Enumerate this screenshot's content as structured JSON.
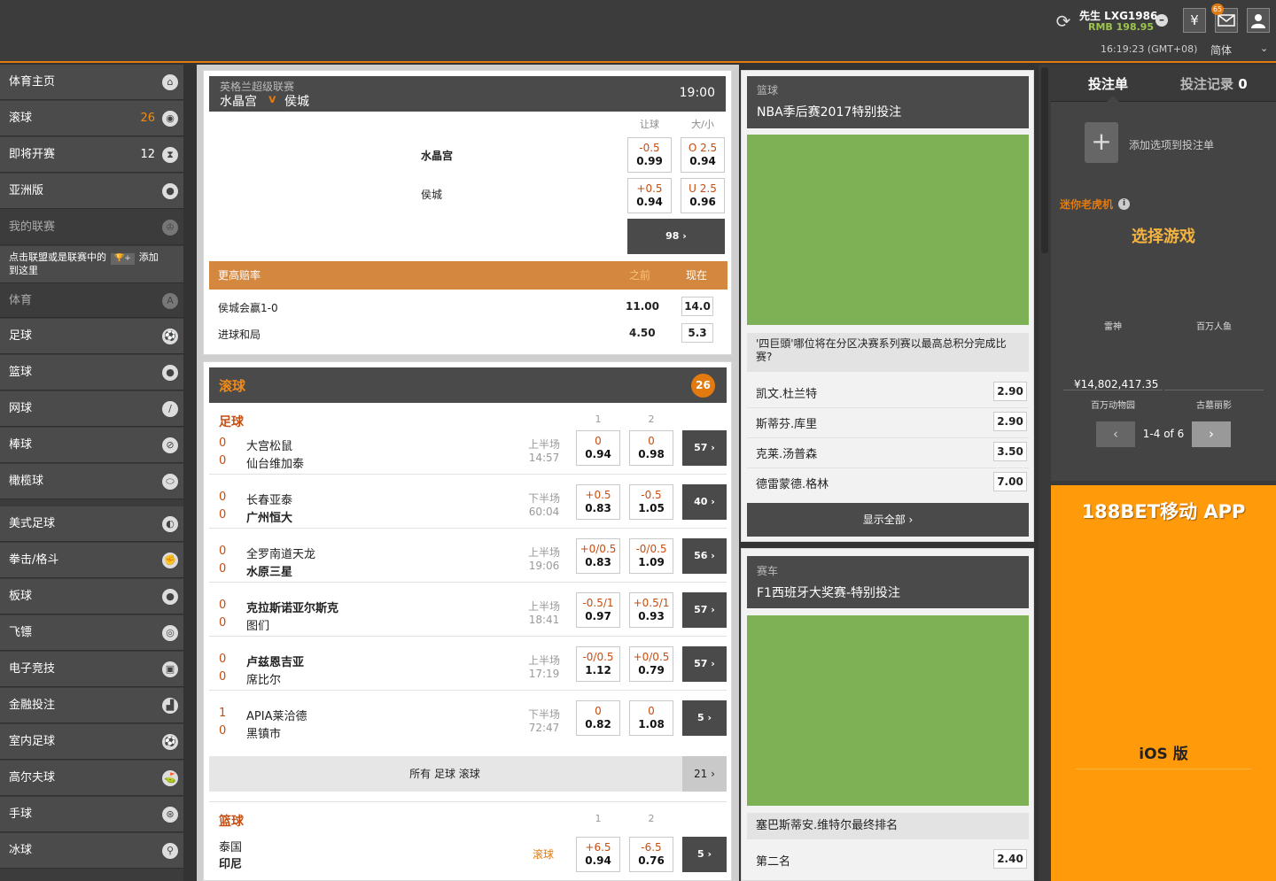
{
  "header": {
    "username": "先生 LXG1986",
    "balance": "RMB 198.95",
    "mail_count": "65",
    "clock": "16:19:23 (GMT+08)",
    "language": "简体",
    "currency_symbol": "¥",
    "refresh_symbol": "⟳",
    "minus_symbol": "–"
  },
  "sidebar": {
    "items": [
      {
        "label": "体育主页",
        "count": "",
        "icon": "home-icon"
      },
      {
        "label": "滚球",
        "count": "26",
        "icon": "live-icon"
      },
      {
        "label": "即将开赛",
        "count": "12",
        "icon": "hourglass-icon"
      },
      {
        "label": "亚洲版",
        "count": "",
        "icon": "globe-icon"
      },
      {
        "label": "我的联赛",
        "count": "",
        "icon": "trophy-icon"
      },
      {
        "label": "体育",
        "count": "",
        "icon": "sort-az-icon"
      },
      {
        "label": "足球",
        "icon": "soccer-icon"
      },
      {
        "label": "篮球",
        "icon": "basketball-icon"
      },
      {
        "label": "网球",
        "icon": "tennis-icon"
      },
      {
        "label": "棒球",
        "icon": "baseball-icon"
      },
      {
        "label": "橄榄球",
        "icon": "rugby-icon"
      },
      {
        "label": "美式足球",
        "icon": "american-football-icon"
      },
      {
        "label": "拳击/格斗",
        "icon": "boxing-icon"
      },
      {
        "label": "板球",
        "icon": "cricket-icon"
      },
      {
        "label": "飞镖",
        "icon": "darts-icon"
      },
      {
        "label": "电子竞技",
        "icon": "esports-icon"
      },
      {
        "label": "金融投注",
        "icon": "finance-icon"
      },
      {
        "label": "室内足球",
        "icon": "futsal-icon"
      },
      {
        "label": "高尔夫球",
        "icon": "golf-icon"
      },
      {
        "label": "手球",
        "icon": "handball-icon"
      },
      {
        "label": "冰球",
        "icon": "ice-hockey-icon"
      }
    ],
    "note": "点击联盟或是联赛中的",
    "note_plus": "🏆+",
    "note_add": "添加",
    "note_tail": "到这里"
  },
  "feature": {
    "league": "英格兰超级联赛",
    "home": "水晶宫",
    "vs": "v",
    "away": "侯城",
    "time": "19:00",
    "col1": "让球",
    "col2": "大/小",
    "rows": [
      {
        "team": "水晶宫",
        "hcap": "-0.5",
        "hcap_price": "0.99",
        "ou": "O 2.5",
        "ou_price": "0.94"
      },
      {
        "team": "侯城",
        "hcap": "+0.5",
        "hcap_price": "0.94",
        "ou": "U 2.5",
        "ou_price": "0.96"
      }
    ],
    "more": "98 ›",
    "boost_title": "更高赔率",
    "boost_before": "之前",
    "boost_now": "现在",
    "boosts": [
      {
        "label": "侯城会赢1-0",
        "before": "11.00",
        "now": "14.0"
      },
      {
        "label": "进球和局",
        "before": "4.50",
        "now": "5.3"
      }
    ]
  },
  "live": {
    "title": "滚球",
    "count": "26",
    "football_title": "足球",
    "col1": "1",
    "col2": "2",
    "matches": [
      {
        "s1": "0",
        "s2": "0",
        "t1": "大宫松鼠",
        "t2": "仙台维加泰",
        "bold": 0,
        "period": "上半场",
        "clock": "14:57",
        "o1t": "0",
        "o1b": "0.94",
        "o2t": "0",
        "o2b": "0.98",
        "more": "57 ›"
      },
      {
        "s1": "0",
        "s2": "0",
        "t1": "长春亚泰",
        "t2": "广州恒大",
        "bold": 2,
        "period": "下半场",
        "clock": "60:04",
        "o1t": "+0.5",
        "o1b": "0.83",
        "o2t": "-0.5",
        "o2b": "1.05",
        "more": "40 ›"
      },
      {
        "s1": "0",
        "s2": "0",
        "t1": "全罗南道天龙",
        "t2": "水原三星",
        "bold": 2,
        "period": "上半场",
        "clock": "19:06",
        "o1t": "+0/0.5",
        "o1b": "0.83",
        "o2t": "-0/0.5",
        "o2b": "1.09",
        "more": "56 ›"
      },
      {
        "s1": "0",
        "s2": "0",
        "t1": "克拉斯诺亚尔斯克",
        "t2": "图们",
        "bold": 1,
        "period": "上半场",
        "clock": "18:41",
        "o1t": "-0.5/1",
        "o1b": "0.97",
        "o2t": "+0.5/1",
        "o2b": "0.93",
        "more": "57 ›"
      },
      {
        "s1": "0",
        "s2": "0",
        "t1": "卢兹恩吉亚",
        "t2": "席比尔",
        "bold": 1,
        "period": "上半场",
        "clock": "17:19",
        "o1t": "-0/0.5",
        "o1b": "1.12",
        "o2t": "+0/0.5",
        "o2b": "0.79",
        "more": "57 ›"
      },
      {
        "s1": "1",
        "s2": "0",
        "t1": "APIA莱洽德",
        "t2": "黑镇市",
        "bold": 0,
        "period": "下半场",
        "clock": "72:47",
        "o1t": "0",
        "o1b": "0.82",
        "o2t": "0",
        "o2b": "1.08",
        "more": "5 ›"
      }
    ],
    "all_label": "所有 足球 滚球",
    "all_count": "21 ›",
    "basketball_title": "篮球",
    "bb": {
      "t1": "泰国",
      "t2": "印尼",
      "status": "滚球",
      "o1t": "+6.5",
      "o1b": "0.94",
      "o2t": "-6.5",
      "o2b": "0.76",
      "more": "5 ›"
    }
  },
  "nba": {
    "category": "篮球",
    "title": "NBA季后赛2017特别投注",
    "question": "'四巨頭'哪位将在分区决赛系列赛以最高总积分完成比赛?",
    "options": [
      {
        "name": "凯文.杜兰特",
        "price": "2.90"
      },
      {
        "name": "斯蒂芬.库里",
        "price": "2.90"
      },
      {
        "name": "克莱.汤普森",
        "price": "3.50"
      },
      {
        "name": "德雷蒙德.格林",
        "price": "7.00"
      }
    ],
    "show_all": "显示全部 ›"
  },
  "f1": {
    "category": "赛车",
    "title": "F1西班牙大奖赛-特别投注",
    "question": "塞巴斯蒂安.维特尔最终排名",
    "option": "第二名",
    "price": "2.40"
  },
  "betslip": {
    "tab1": "投注单",
    "tab2": "投注记录",
    "tab2_count": "0",
    "empty": "添加选项到投注单"
  },
  "slots": {
    "title": "迷你老虎机",
    "choose": "选择游戏",
    "games": [
      "雷神",
      "百万人鱼",
      "百万动物园",
      "古墓丽影"
    ],
    "jackpot": "¥14,802,417.35",
    "pager": "1-4 of 6"
  },
  "app": {
    "title": "188BET移动 APP",
    "platform": "iOS 版"
  },
  "colors": {
    "accent": "#e27a10",
    "odds_top": "#c84d10",
    "green_banner": "#7eb055",
    "orange_banner": "#ff9a0a",
    "balance": "#9dc54d"
  }
}
